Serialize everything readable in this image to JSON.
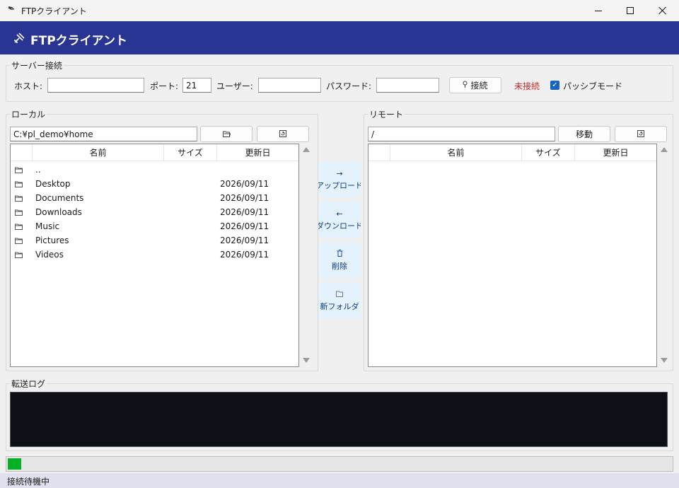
{
  "window": {
    "title": "FTPクライアント",
    "app_icon": "feather-icon"
  },
  "header": {
    "title": "FTPクライアント",
    "icon": "satellite-icon"
  },
  "server": {
    "legend": "サーバー接続",
    "host_label": "ホスト:",
    "host_value": "",
    "port_label": "ポート:",
    "port_value": "21",
    "user_label": "ユーザー:",
    "user_value": "",
    "password_label": "パスワード:",
    "password_value": "",
    "connect_icon": "plug-icon",
    "connect_label": "接続",
    "status": "未接続",
    "status_color": "#c62828",
    "passive_label": "パッシブモード",
    "passive_checked": true
  },
  "local": {
    "legend": "ローカル",
    "path": "C:¥pl_demo¥home",
    "browse_icon": "open-folder-icon",
    "refresh_icon": "refresh-icon",
    "columns": [
      "名前",
      "サイズ",
      "更新日"
    ],
    "rows": [
      {
        "name": "..",
        "size": "",
        "date": ""
      },
      {
        "name": "Desktop",
        "size": "",
        "date": "2026/09/11"
      },
      {
        "name": "Documents",
        "size": "",
        "date": "2026/09/11"
      },
      {
        "name": "Downloads",
        "size": "",
        "date": "2026/09/11"
      },
      {
        "name": "Music",
        "size": "",
        "date": "2026/09/11"
      },
      {
        "name": "Pictures",
        "size": "",
        "date": "2026/09/11"
      },
      {
        "name": "Videos",
        "size": "",
        "date": "2026/09/11"
      }
    ]
  },
  "actions": {
    "upload_icon": "→",
    "upload_label": "アップロード",
    "download_icon": "←",
    "download_label": "ダウンロード",
    "delete_icon": "🗑",
    "delete_label": "削除",
    "mkdir_icon": "📁",
    "mkdir_label": "新フォルダ",
    "button_bg": "#e3f2fd"
  },
  "remote": {
    "legend": "リモート",
    "path": "/",
    "move_label": "移動",
    "refresh_icon": "refresh-icon",
    "columns": [
      "名前",
      "サイズ",
      "更新日"
    ],
    "rows": []
  },
  "log": {
    "legend": "転送ログ",
    "background": "#0d1117"
  },
  "progress": {
    "value": 0.02,
    "color": "#06b025"
  },
  "statusbar": {
    "text": "接続待機中"
  },
  "colors": {
    "header_bg": "#283593",
    "statusbar_bg": "#dfe1ef"
  }
}
